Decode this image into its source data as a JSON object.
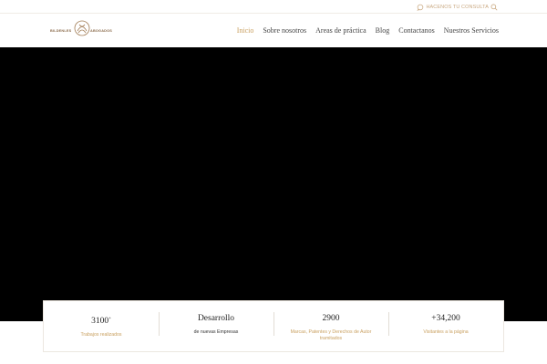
{
  "topbar": {
    "consult_label": "HACENOS TU CONSULTA",
    "consult_icon": "chat-icon",
    "search_icon": "search-icon",
    "accent_color": "#c9a880"
  },
  "logo": {
    "left_text": "BILDENLES",
    "right_text": "ABOGADOS"
  },
  "nav": {
    "items": [
      {
        "label": "Inicio",
        "active": true
      },
      {
        "label": "Sobre nosotros",
        "active": false
      },
      {
        "label": "Areas de práctica",
        "active": false
      },
      {
        "label": "Blog",
        "active": false
      },
      {
        "label": "Contactanos",
        "active": false
      },
      {
        "label": "Nuestros Servicios",
        "active": false
      }
    ],
    "active_color": "#c9a060"
  },
  "hero": {
    "background": "#000000"
  },
  "stats": [
    {
      "value": "3100",
      "suffix": "+",
      "label": "Trabajos realizados"
    },
    {
      "value": "Desarrollo",
      "suffix": "",
      "label": "de nuevas Empresas"
    },
    {
      "value": "2900",
      "suffix": "",
      "label": "Marcas, Patentes y Derechos de Autor tramitados"
    },
    {
      "value": "+34,200",
      "suffix": "",
      "label": "Visitantes a la página"
    }
  ]
}
